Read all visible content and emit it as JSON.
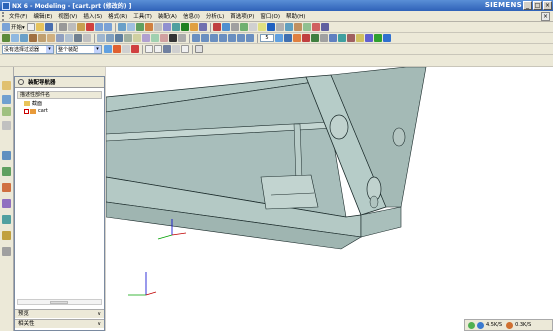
{
  "window": {
    "title": "NX 6 - Modeling - [cart.prt  (修改的) ]",
    "brand": "SIEMENS",
    "controls": [
      "_",
      "□",
      "×"
    ]
  },
  "menu": {
    "items": [
      "文件(F)",
      "编辑(E)",
      "视图(V)",
      "插入(S)",
      "格式(R)",
      "工具(T)",
      "装配(A)",
      "信息(I)",
      "分析(L)",
      "首选项(P)",
      "窗口(O)",
      "帮助(H)"
    ]
  },
  "toolbar1": {
    "start_label": "开始▾"
  },
  "toolbar2": {
    "zoom_value": "5"
  },
  "toolbar3": {
    "filter_label": "没有选择过滤器",
    "scope_label": "整个装配"
  },
  "navigator": {
    "title": "装配导航器",
    "column_header": "描述性部件名",
    "tree": [
      {
        "label": "截面"
      },
      {
        "label": "cart"
      }
    ],
    "sections": [
      "预览",
      "相关性"
    ]
  },
  "status": {
    "tray_values": [
      "4.5K/S",
      "0.3K/S"
    ]
  },
  "colors": {
    "title_blue": "#2f62b8",
    "model_face": "#b2c8c4",
    "model_edge": "#1a2a2a",
    "triad_x": "#c00000",
    "triad_y": "#00a000",
    "triad_z": "#0000d0"
  }
}
